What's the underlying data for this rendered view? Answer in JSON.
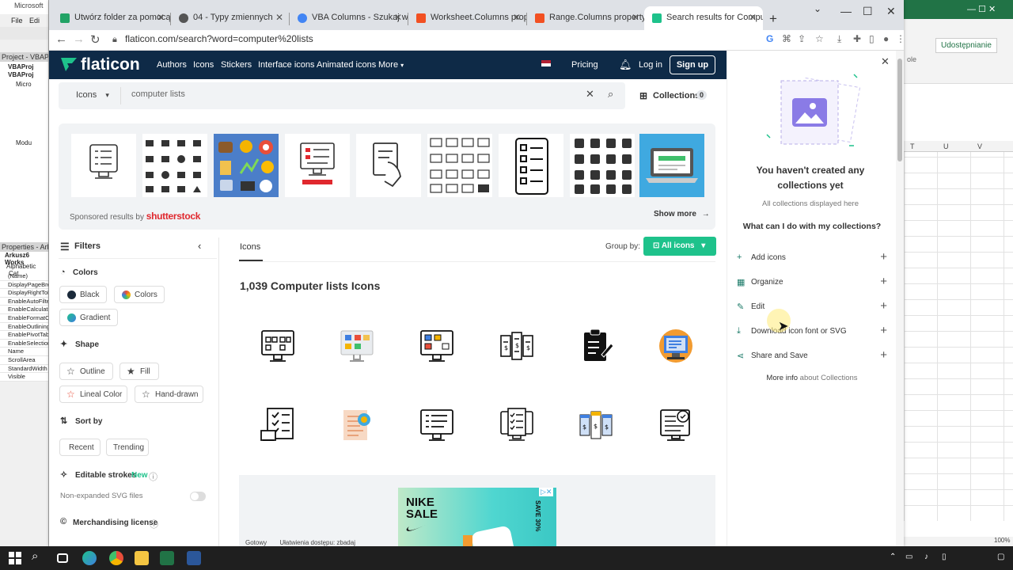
{
  "vba": {
    "title": "Microsoft",
    "menu_file": "File",
    "menu_edit": "Edi",
    "project_label": "Project - VBAPr",
    "tree_items": [
      "VBAProj",
      "VBAProj",
      "Micro",
      "Modu"
    ],
    "props_label": "Properties - Arku",
    "props_object": "Arkusz6 Works",
    "props_tab_alpha": "Alphabetic",
    "props_tab_cat": "Cat",
    "props_rows": [
      "(Name)",
      "DisplayPageBrea",
      "DisplayRightToL",
      "EnableAutoFilter",
      "EnableCalculatio",
      "EnableFormatCo",
      "EnableOutlining",
      "EnablePivotTab",
      "EnableSelection",
      "Name",
      "ScrollArea",
      "StandardWidth",
      "Visible"
    ]
  },
  "excel": {
    "share_label": "Udostępnianie",
    "stub_text": "ole",
    "columns": [
      "T",
      "U",
      "V"
    ],
    "status_ready": "Gotowy",
    "status_accessibility": "Ułatwienia dostępu: zbadaj",
    "zoom": "100%"
  },
  "browser": {
    "tabs": [
      {
        "title": "Utwórz folder za pomocą VBA",
        "favicon_color": "#21a366"
      },
      {
        "title": "04 - Typy zmiennych",
        "favicon_color": "#555555"
      },
      {
        "title": "VBA Columns - Szukaj w Goo",
        "favicon_color": "#4285f4"
      },
      {
        "title": "Worksheet.Columns property",
        "favicon_color": "#f25022"
      },
      {
        "title": "Range.Columns property (Exc",
        "favicon_color": "#f25022"
      },
      {
        "title": "Search results for Computer",
        "favicon_color": "#1ec28b"
      }
    ],
    "new_tab": "+",
    "url": "flaticon.com/search?word=computer%20lists"
  },
  "nav": {
    "logo": "flaticon",
    "links": [
      "Authors",
      "Icons",
      "Stickers",
      "Interface icons",
      "Animated icons",
      "More"
    ],
    "pricing": "Pricing",
    "login": "Log in",
    "signup": "Sign up"
  },
  "search": {
    "type": "Icons",
    "query": "computer lists",
    "collections_label": "Collections",
    "collections_count": "0"
  },
  "sponsored": {
    "label": "Sponsored results by",
    "brand": "shutterstock",
    "show_more": "Show more"
  },
  "filters": {
    "title": "Filters",
    "colors_title": "Colors",
    "color_chips": [
      "Black",
      "Colors",
      "Gradient"
    ],
    "shape_title": "Shape",
    "shape_chips": [
      "Outline",
      "Fill",
      "Lineal Color",
      "Hand-drawn"
    ],
    "sort_title": "Sort by",
    "sort_chips": [
      "Recent",
      "Trending"
    ],
    "editable_title": "Editable strokes",
    "editable_badge": "New",
    "non_expanded": "Non-expanded SVG files",
    "merch_title": "Merchandising license"
  },
  "results": {
    "tab_label": "Icons",
    "group_by_label": "Group by:",
    "group_by_value": "All icons",
    "heading": "1,039 Computer lists Icons"
  },
  "ad": {
    "brand": "NIKE",
    "word": "SALE",
    "vertical": "SAVE 30%"
  },
  "panel": {
    "empty_title": "You haven't created any collections yet",
    "subtitle": "All collections displayed here",
    "question": "What can I do with my collections?",
    "items": [
      {
        "label": "Add icons",
        "icon": "+"
      },
      {
        "label": "Organize",
        "icon": "▦"
      },
      {
        "label": "Edit",
        "icon": "✎"
      },
      {
        "label": "Download icon font or SVG",
        "icon": "⤓"
      },
      {
        "label": "Share and Save",
        "icon": "⋖"
      }
    ],
    "more_info": "More info",
    "more_info_link": "about Collections"
  },
  "colors": {
    "nav_bg": "#0e2a47",
    "accent_green": "#1ec28b",
    "shutterstock_red": "#e0282e",
    "collection_icon": "#1b7a68"
  }
}
